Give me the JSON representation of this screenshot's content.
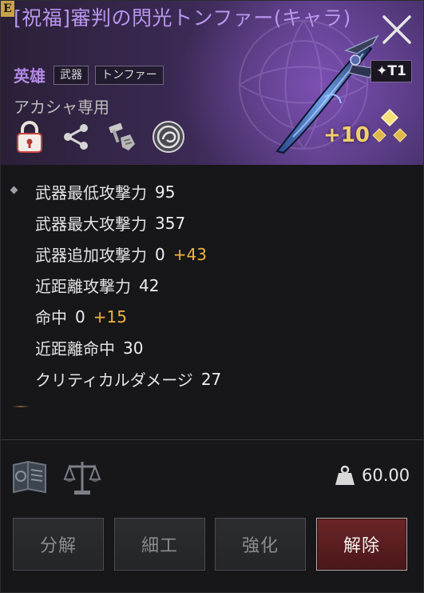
{
  "item": {
    "badge": "E",
    "title": "[祝福]審判の閃光トンファー(キャラ)",
    "rarity": "英雄",
    "tags": [
      "武器",
      "トンファー"
    ],
    "exclusive": "アカシャ専用",
    "tier": "✦T1",
    "enhancement": "+10",
    "icons": [
      "lock-icon",
      "share-icon",
      "craft-hammer-icon",
      "engrave-rune-icon"
    ]
  },
  "stats": [
    {
      "label": "武器最低攻撃力",
      "value": "95",
      "bonus": ""
    },
    {
      "label": "武器最大攻撃力",
      "value": "357",
      "bonus": ""
    },
    {
      "label": "武器追加攻撃力",
      "value": "0",
      "bonus": "+43"
    },
    {
      "label": "近距離攻撃力",
      "value": "42",
      "bonus": ""
    },
    {
      "label": "命中",
      "value": "0",
      "bonus": "+15"
    },
    {
      "label": "近距離命中",
      "value": "30",
      "bonus": ""
    },
    {
      "label": "クリティカルダメージ",
      "value": "27",
      "bonus": ""
    }
  ],
  "footer": {
    "weight": "60.00",
    "icons": [
      "book-icon",
      "scales-icon",
      "weight-icon"
    ]
  },
  "buttons": {
    "disassemble": "分解",
    "craft": "細工",
    "enhance": "強化",
    "release": "解除"
  },
  "colors": {
    "title": "#b896ee",
    "bonus": "#f0b33a",
    "enhancement": "#f3cf6a",
    "release_button": "#6b2528"
  }
}
